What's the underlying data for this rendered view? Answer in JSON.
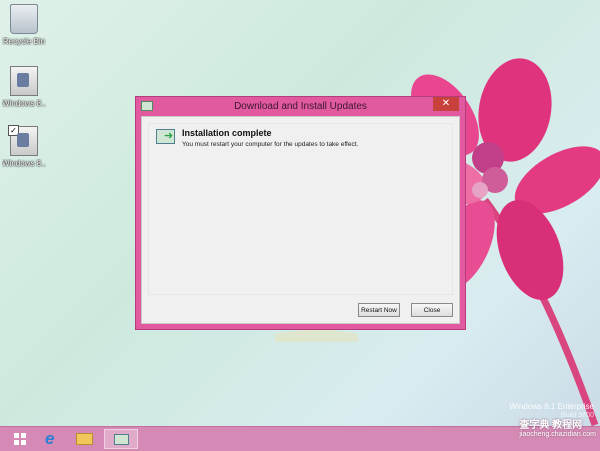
{
  "desktop": {
    "icons": [
      {
        "label": "Recycle Bin",
        "icon": "recycle-bin-icon"
      },
      {
        "label": "Windows 8...",
        "icon": "installer-icon"
      },
      {
        "label": "Windows 8...",
        "icon": "installer-icon"
      }
    ],
    "os_name": "Windows 8.1 Enterprise",
    "os_build": "Build 9600"
  },
  "dialog": {
    "title": "Download and Install Updates",
    "close_glyph": "✕",
    "heading": "Installation complete",
    "message": "You must restart your computer for the updates to take effect.",
    "buttons": {
      "restart": "Restart Now",
      "close": "Close"
    }
  },
  "taskbar": {
    "items": [
      "start-button",
      "internet-explorer",
      "file-explorer",
      "windows-update"
    ]
  },
  "watermark": {
    "site": "查字典 教程网",
    "url": "jiaocheng.chazidian.com"
  },
  "colors": {
    "window_frame": "#e15aa0",
    "taskbar": "#d48ab4",
    "close_button": "#c9413d"
  }
}
